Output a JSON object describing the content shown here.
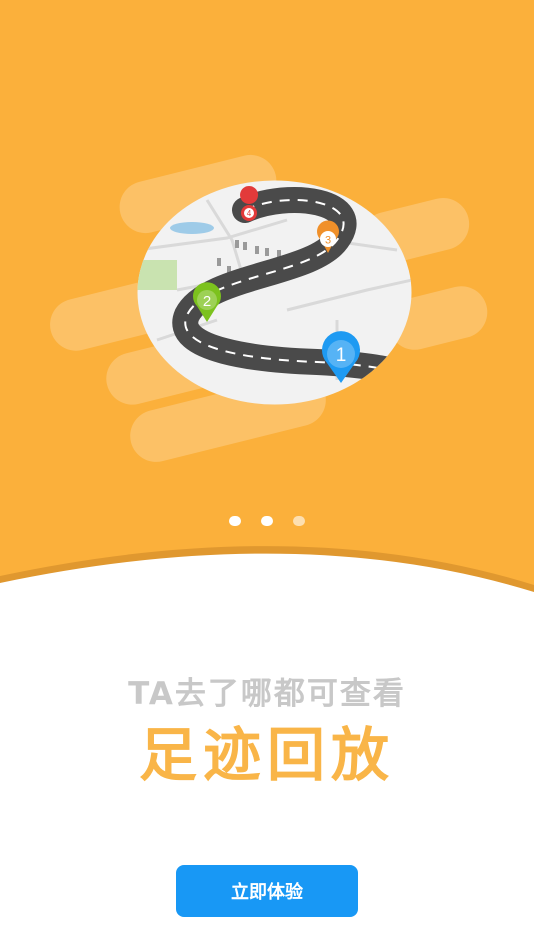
{
  "onboarding": {
    "subtitle": "TA去了哪都可查看",
    "title": "足迹回放",
    "cta_label": "立即体验",
    "page_indicator": {
      "total": 3,
      "current": 1
    },
    "map_markers": [
      "1",
      "2",
      "3",
      "4"
    ]
  },
  "colors": {
    "hero_background": "#fbb03b",
    "wave_shadow": "#e0982f",
    "subtitle": "#c8c8c8",
    "title": "#f9b548",
    "button": "#1898f5",
    "marker_1": "#1e9af2",
    "marker_2": "#7cc21e",
    "marker_3": "#f0902a",
    "marker_4": "#e23a3a"
  },
  "icons": {
    "illustration": "winding-road-map-icon",
    "marker": "map-pin-icon"
  }
}
